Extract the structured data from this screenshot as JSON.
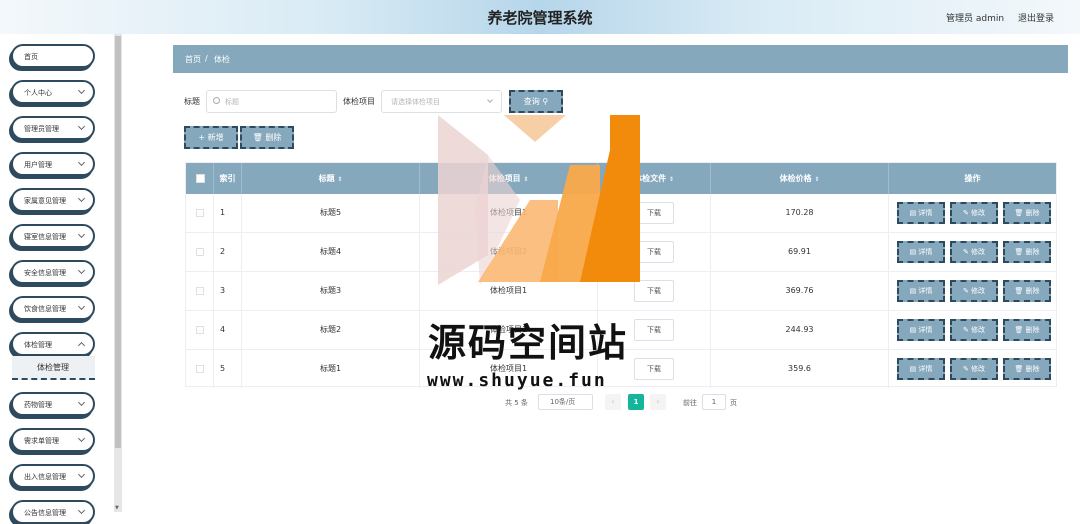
{
  "header": {
    "title": "养老院管理系统",
    "user": "管理员 admin",
    "logout": "退出登录"
  },
  "sidebar": {
    "items": [
      {
        "label": "首页"
      },
      {
        "label": "个人中心"
      },
      {
        "label": "管理员管理"
      },
      {
        "label": "用户管理"
      },
      {
        "label": "家属意见管理"
      },
      {
        "label": "寝室信息管理"
      },
      {
        "label": "安全信息管理"
      },
      {
        "label": "饮食信息管理"
      },
      {
        "label": "体检管理"
      },
      {
        "label": "药物管理"
      },
      {
        "label": "需求单管理"
      },
      {
        "label": "出入信息管理"
      },
      {
        "label": "公告信息管理"
      }
    ],
    "active_sub": "体检管理"
  },
  "breadcrumb": {
    "home": "首页",
    "sep": "/",
    "current": "体检"
  },
  "search": {
    "title_label": "标题",
    "title_placeholder": "标题",
    "item_label": "体检项目",
    "item_placeholder": "请选择体检项目",
    "query_button": "查询"
  },
  "actions": {
    "add": "+ 新增",
    "delete": "删除"
  },
  "table": {
    "headers": {
      "index": "索引",
      "title": "标题",
      "item": "体检项目",
      "file": "体检文件",
      "price": "体检价格",
      "ops": "操作"
    },
    "rows": [
      {
        "index": "1",
        "title": "标题5",
        "item": "体检项目1",
        "file": "下载",
        "price": "170.28"
      },
      {
        "index": "2",
        "title": "标题4",
        "item": "体检项目2",
        "file": "下载",
        "price": "69.91"
      },
      {
        "index": "3",
        "title": "标题3",
        "item": "体检项目1",
        "file": "下载",
        "price": "369.76"
      },
      {
        "index": "4",
        "title": "标题2",
        "item": "体检项目1",
        "file": "下载",
        "price": "244.93"
      },
      {
        "index": "5",
        "title": "标题1",
        "item": "体检项目1",
        "file": "下载",
        "price": "359.6"
      }
    ],
    "row_buttons": {
      "detail": "详情",
      "edit": "修改",
      "delete": "删除"
    }
  },
  "pagination": {
    "total": "共 5 条",
    "page_size": "10条/页",
    "current": "1",
    "goto_label": "前往",
    "goto_value": "1",
    "page_suffix": "页"
  },
  "watermark": {
    "text": "源码空间站",
    "url": "www.shuyue.fun"
  }
}
